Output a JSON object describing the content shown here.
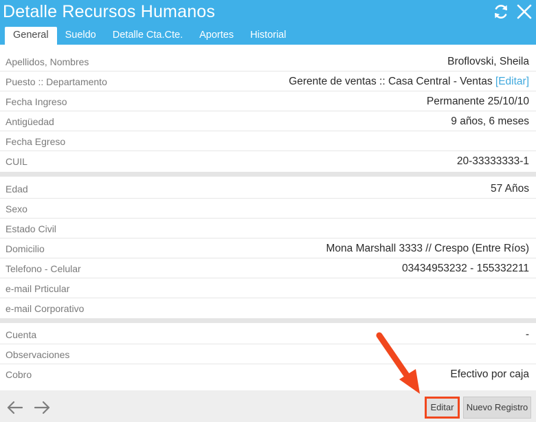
{
  "window": {
    "title": "Detalle Recursos Humanos"
  },
  "tabs": [
    {
      "label": "General",
      "active": true
    },
    {
      "label": "Sueldo",
      "active": false
    },
    {
      "label": "Detalle Cta.Cte.",
      "active": false
    },
    {
      "label": "Aportes",
      "active": false
    },
    {
      "label": "Historial",
      "active": false
    }
  ],
  "section1": [
    {
      "label": "Apellidos, Nombres",
      "value": "Broflovski, Sheila"
    },
    {
      "label": "Puesto :: Departamento",
      "value": "Gerente de ventas :: Casa Central - Ventas",
      "link": "[Editar]"
    },
    {
      "label": "Fecha Ingreso",
      "value": "Permanente 25/10/10"
    },
    {
      "label": "Antigüedad",
      "value": "9 años, 6 meses"
    },
    {
      "label": "Fecha Egreso",
      "value": ""
    },
    {
      "label": "CUIL",
      "value": "20-33333333-1"
    }
  ],
  "section2": [
    {
      "label": "Edad",
      "value": "57 Años"
    },
    {
      "label": "Sexo",
      "value": ""
    },
    {
      "label": "Estado Civil",
      "value": ""
    },
    {
      "label": "Domicilio",
      "value": "Mona Marshall 3333 // Crespo (Entre Ríos)"
    },
    {
      "label": "Telefono - Celular",
      "value": "03434953232 - 155332211"
    },
    {
      "label": "e-mail Prticular",
      "value": ""
    },
    {
      "label": "e-mail Corporativo",
      "value": ""
    }
  ],
  "section3": [
    {
      "label": "Cuenta",
      "value": "-"
    },
    {
      "label": "Observaciones",
      "value": ""
    },
    {
      "label": "Cobro",
      "value": "Efectivo por caja"
    }
  ],
  "footer": {
    "edit_label": "Editar",
    "new_label": "Nuevo Registro"
  },
  "icons": {
    "refresh": "refresh-icon",
    "close": "close-icon",
    "back": "arrow-left-icon",
    "forward": "arrow-right-icon"
  },
  "colors": {
    "header": "#3fb0e8",
    "link": "#3fa8dd",
    "highlight": "#f1471d"
  }
}
